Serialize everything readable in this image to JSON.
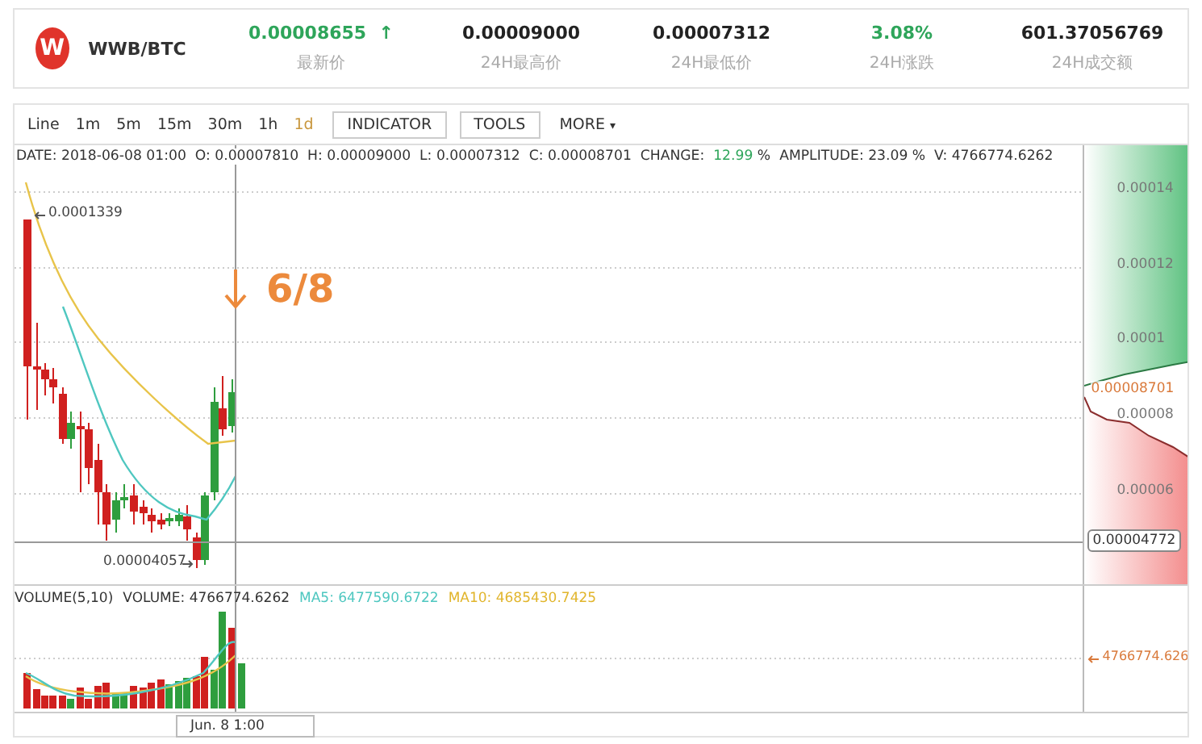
{
  "ticker": {
    "logo_text": "W",
    "pair": "WWB/BTC",
    "stats": [
      {
        "value": "0.00008655",
        "label": "最新价",
        "kind": "up",
        "arrow": "↑"
      },
      {
        "value": "0.00009000",
        "label": "24H最高价",
        "kind": "plain"
      },
      {
        "value": "0.00007312",
        "label": "24H最低价",
        "kind": "plain"
      },
      {
        "value": "3.08%",
        "label": "24H涨跌",
        "kind": "up"
      },
      {
        "value": "601.37056769",
        "label": "24H成交额",
        "kind": "plain"
      }
    ]
  },
  "toolbar": {
    "intervals": [
      {
        "label": "Line",
        "selected": false
      },
      {
        "label": "1m",
        "selected": false
      },
      {
        "label": "5m",
        "selected": false
      },
      {
        "label": "15m",
        "selected": false
      },
      {
        "label": "30m",
        "selected": false
      },
      {
        "label": "1h",
        "selected": false
      },
      {
        "label": "1d",
        "selected": true
      }
    ],
    "buttons": [
      "INDICATOR",
      "TOOLS"
    ],
    "more": "MORE",
    "more_caret": "▾"
  },
  "info_line": {
    "date_label": "DATE:",
    "date": "2018-06-08  01:00",
    "open_label": "O:",
    "open": "0.00007810",
    "high_label": "H:",
    "high": "0.00009000",
    "low_label": "L:",
    "low": "0.00007312",
    "close_label": "C:",
    "close": "0.00008701",
    "change_label": "CHANGE:",
    "change": "12.99",
    "change_unit": "%",
    "amplitude_label": "AMPLITUDE:",
    "amplitude": "23.09 %",
    "volume_label": "V:",
    "volume": "4766774.6262"
  },
  "chart": {
    "high_mark": "0.0001339",
    "low_mark": "0.00004057",
    "annotation": "6/8",
    "y_axis": [
      "0.00014",
      "0.00012",
      "0.0001",
      "0.00008",
      "0.00006"
    ],
    "last_price": "0.00008701",
    "cursor_price": "0.00004772"
  },
  "volume": {
    "title": "VOLUME(5,10)",
    "volume_label": "VOLUME:",
    "volume": "4766774.6262",
    "ma5": "MA5: 6477590.6722",
    "ma10": "MA10: 4685430.7425",
    "axis_value": "4766774.626"
  },
  "x_axis": {
    "cursor_label": "Jun. 8  1:00"
  }
}
